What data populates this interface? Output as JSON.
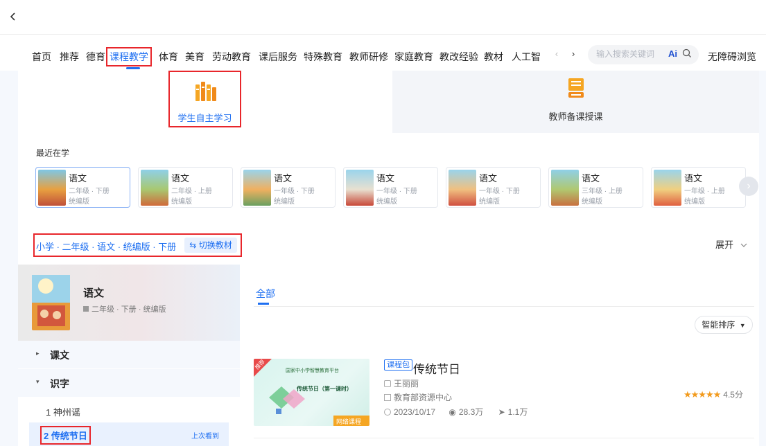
{
  "nav": {
    "tabs": [
      "首页",
      "推荐",
      "德育",
      "课程教学",
      "体育",
      "美育",
      "劳动教育",
      "课后服务",
      "特殊教育",
      "教师研修",
      "家庭教育",
      "教改经验",
      "教材",
      "人工智"
    ],
    "active_tab": "课程教学",
    "search_placeholder": "输入搜索关键词",
    "ai_badge": "Ai",
    "accessibility": "无障碍浏览",
    "prev_icon": "chevron-left-icon",
    "next_icon": "chevron-right-icon"
  },
  "modes": {
    "student": "学生自主学习",
    "teacher": "教师备课授课"
  },
  "recent": {
    "label": "最近在学",
    "books": [
      {
        "title": "语文",
        "grade": "二年级 · 下册",
        "edition": "统编版"
      },
      {
        "title": "语文",
        "grade": "二年级 · 上册",
        "edition": "统编版"
      },
      {
        "title": "语文",
        "grade": "一年级 · 下册",
        "edition": "统编版"
      },
      {
        "title": "语文",
        "grade": "一年级 · 下册",
        "edition": "统编版"
      },
      {
        "title": "语文",
        "grade": "一年级 · 下册",
        "edition": "统编版"
      },
      {
        "title": "语文",
        "grade": "三年级 · 上册",
        "edition": "统编版"
      },
      {
        "title": "语文",
        "grade": "一年级 · 上册",
        "edition": "统编版"
      }
    ]
  },
  "filter": {
    "breadcrumb": "小学 · 二年级 · 语文 · 统编版 · 下册",
    "switch": "切换教材",
    "expand": "展开"
  },
  "panel": {
    "title": "语文",
    "subtitle": "二年级 · 下册 · 统编版",
    "nodes": [
      {
        "label": "课文",
        "expanded": false
      },
      {
        "label": "识字",
        "expanded": true
      }
    ],
    "lessons": [
      {
        "label": "1 神州谣"
      },
      {
        "label": "2 传统节日",
        "badge": "上次看到"
      }
    ]
  },
  "content": {
    "tab": "全部",
    "sort": "智能排序",
    "course": {
      "tag": "课程包",
      "title": "传统节日",
      "teacher": "王丽丽",
      "source": "教育部资源中心",
      "date": "2023/10/17",
      "views": "28.3万",
      "likes": "1.1万",
      "rating_text": "4.5分",
      "rating": 4.5,
      "thumb_badge": "推荐",
      "thumb_heading": "传统节日（第一课时）",
      "thumb_brand": "国家中小学智慧教育平台",
      "thumb_footer": "网络课程"
    }
  },
  "colors": {
    "accent": "#1e6ff1",
    "highlight_box": "#e8262b",
    "star": "#f29a1c"
  }
}
